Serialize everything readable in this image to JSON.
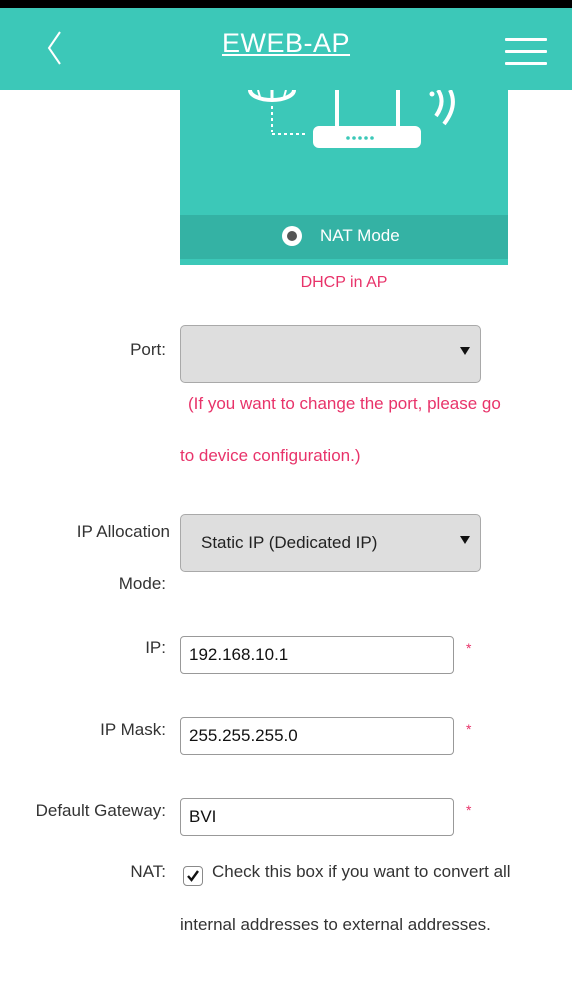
{
  "header": {
    "title": "EWEB-AP",
    "back_icon": "chevron-left-icon",
    "menu_icon": "hamburger-menu-icon"
  },
  "mode_card": {
    "illustration_icons": [
      "globe-icon",
      "router-icon",
      "wifi-signal-icon"
    ],
    "mode_label": "NAT Mode",
    "selected": true
  },
  "dhcp_text": "DHCP in AP",
  "port": {
    "label": "Port:",
    "value": "",
    "note_line1": "(If you want to change the port, please go",
    "note_line2": "to device configuration.)"
  },
  "ip_allocation": {
    "label_line1": "IP Allocation",
    "label_line2": "Mode:",
    "value": "Static IP (Dedicated IP)"
  },
  "ip": {
    "label": "IP:",
    "value": "192.168.10.1",
    "required_mark": "*"
  },
  "ip_mask": {
    "label": "IP Mask:",
    "value": "255.255.255.0",
    "required_mark": "*"
  },
  "gateway": {
    "label": "Default Gateway:",
    "value": "BVI",
    "required_mark": "*"
  },
  "nat": {
    "label": "NAT:",
    "checked": true,
    "desc_line1": "Check this box if you want to convert all",
    "desc_line2": "internal addresses to external addresses."
  },
  "colors": {
    "accent": "#3cc8b8",
    "accent_dark": "#34b2a4",
    "warning_text": "#e8336a"
  }
}
